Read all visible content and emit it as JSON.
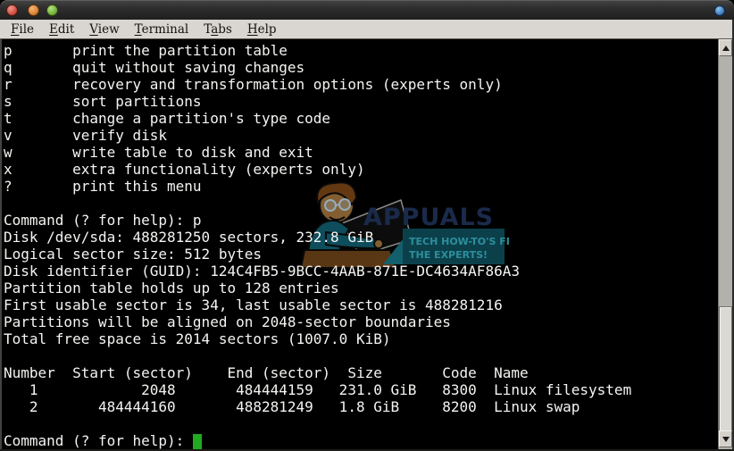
{
  "titlebar": {
    "buttons": [
      {
        "name": "close",
        "color": "#d4584a"
      },
      {
        "name": "minimize",
        "color": "#dd8a3d"
      },
      {
        "name": "maximize",
        "color": "#7cb845"
      }
    ],
    "window_menu_color": "#4a86c8"
  },
  "menubar": {
    "items": [
      {
        "pre": "",
        "u": "F",
        "post": "ile"
      },
      {
        "pre": "",
        "u": "E",
        "post": "dit"
      },
      {
        "pre": "",
        "u": "V",
        "post": "iew"
      },
      {
        "pre": "",
        "u": "T",
        "post": "erminal"
      },
      {
        "pre": "T",
        "u": "a",
        "post": "bs"
      },
      {
        "pre": "",
        "u": "H",
        "post": "elp"
      }
    ]
  },
  "terminal": {
    "background": "#000000",
    "text_color": "#f4f4f2",
    "cursor_color": "#1faa1f",
    "lines": [
      "p       print the partition table",
      "q       quit without saving changes",
      "r       recovery and transformation options (experts only)",
      "s       sort partitions",
      "t       change a partition's type code",
      "v       verify disk",
      "w       write table to disk and exit",
      "x       extra functionality (experts only)",
      "?       print this menu",
      "",
      "Command (? for help): p",
      "Disk /dev/sda: 488281250 sectors, 232.8 GiB",
      "Logical sector size: 512 bytes",
      "Disk identifier (GUID): 124C4FB5-9BCC-4AAB-871E-DC4634AF86A3",
      "Partition table holds up to 128 entries",
      "First usable sector is 34, last usable sector is 488281216",
      "Partitions will be aligned on 2048-sector boundaries",
      "Total free space is 2014 sectors (1007.0 KiB)",
      "",
      "Number  Start (sector)    End (sector)  Size       Code  Name",
      "   1            2048       484444159   231.0 GiB   8300  Linux filesystem",
      "   2       484444160       488281249   1.8 GiB     8200  Linux swap",
      ""
    ],
    "prompt": "Command (? for help): ",
    "partition_table": {
      "headers": [
        "Number",
        "Start (sector)",
        "End (sector)",
        "Size",
        "Code",
        "Name"
      ],
      "rows": [
        [
          "1",
          "2048",
          "484444159",
          "231.0 GiB",
          "8300",
          "Linux filesystem"
        ],
        [
          "2",
          "484444160",
          "488281249",
          "1.8 GiB",
          "8200",
          "Linux swap"
        ]
      ]
    }
  },
  "watermark": {
    "brand": "APPUALS",
    "tagline1": "TECH HOW-TO'S FROM",
    "tagline2": "THE EXPERTS!",
    "brand_color": "#1c2d4f",
    "box_color": "#0c4450"
  }
}
